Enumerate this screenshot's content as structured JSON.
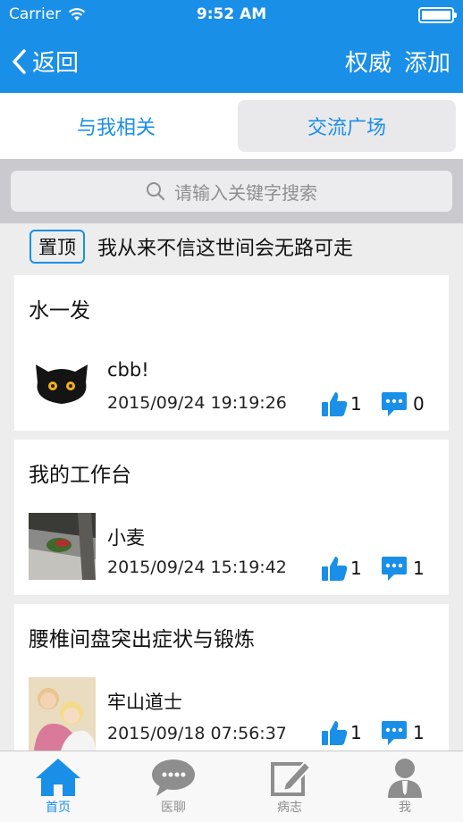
{
  "status_bar": {
    "carrier": "Carrier",
    "time": "9:52 AM"
  },
  "nav": {
    "back_label": "返回",
    "authority_label": "权威",
    "add_label": "添加"
  },
  "segments": {
    "tab1": "与我相关",
    "tab2": "交流广场"
  },
  "search": {
    "placeholder": "请输入关键字搜索"
  },
  "pinned": {
    "badge": "置顶",
    "text": "我从来不信这世间会无路可走"
  },
  "posts": [
    {
      "title": "水一发",
      "author": "cbb!",
      "date": "2015/09/24 19:19:26",
      "likes": "1",
      "comments": "0"
    },
    {
      "title": "我的工作台",
      "author": "小麦",
      "date": "2015/09/24 15:19:42",
      "likes": "1",
      "comments": "1"
    },
    {
      "title": "腰椎间盘突出症状与锻炼",
      "author": "牢山道士",
      "date": "2015/09/18 07:56:37",
      "likes": "1",
      "comments": "1"
    }
  ],
  "tab_bar": {
    "home": "首页",
    "chat": "医聊",
    "record": "病志",
    "me": "我"
  },
  "colors": {
    "accent": "#1a8fe8",
    "inactive": "#8e8e8e"
  }
}
